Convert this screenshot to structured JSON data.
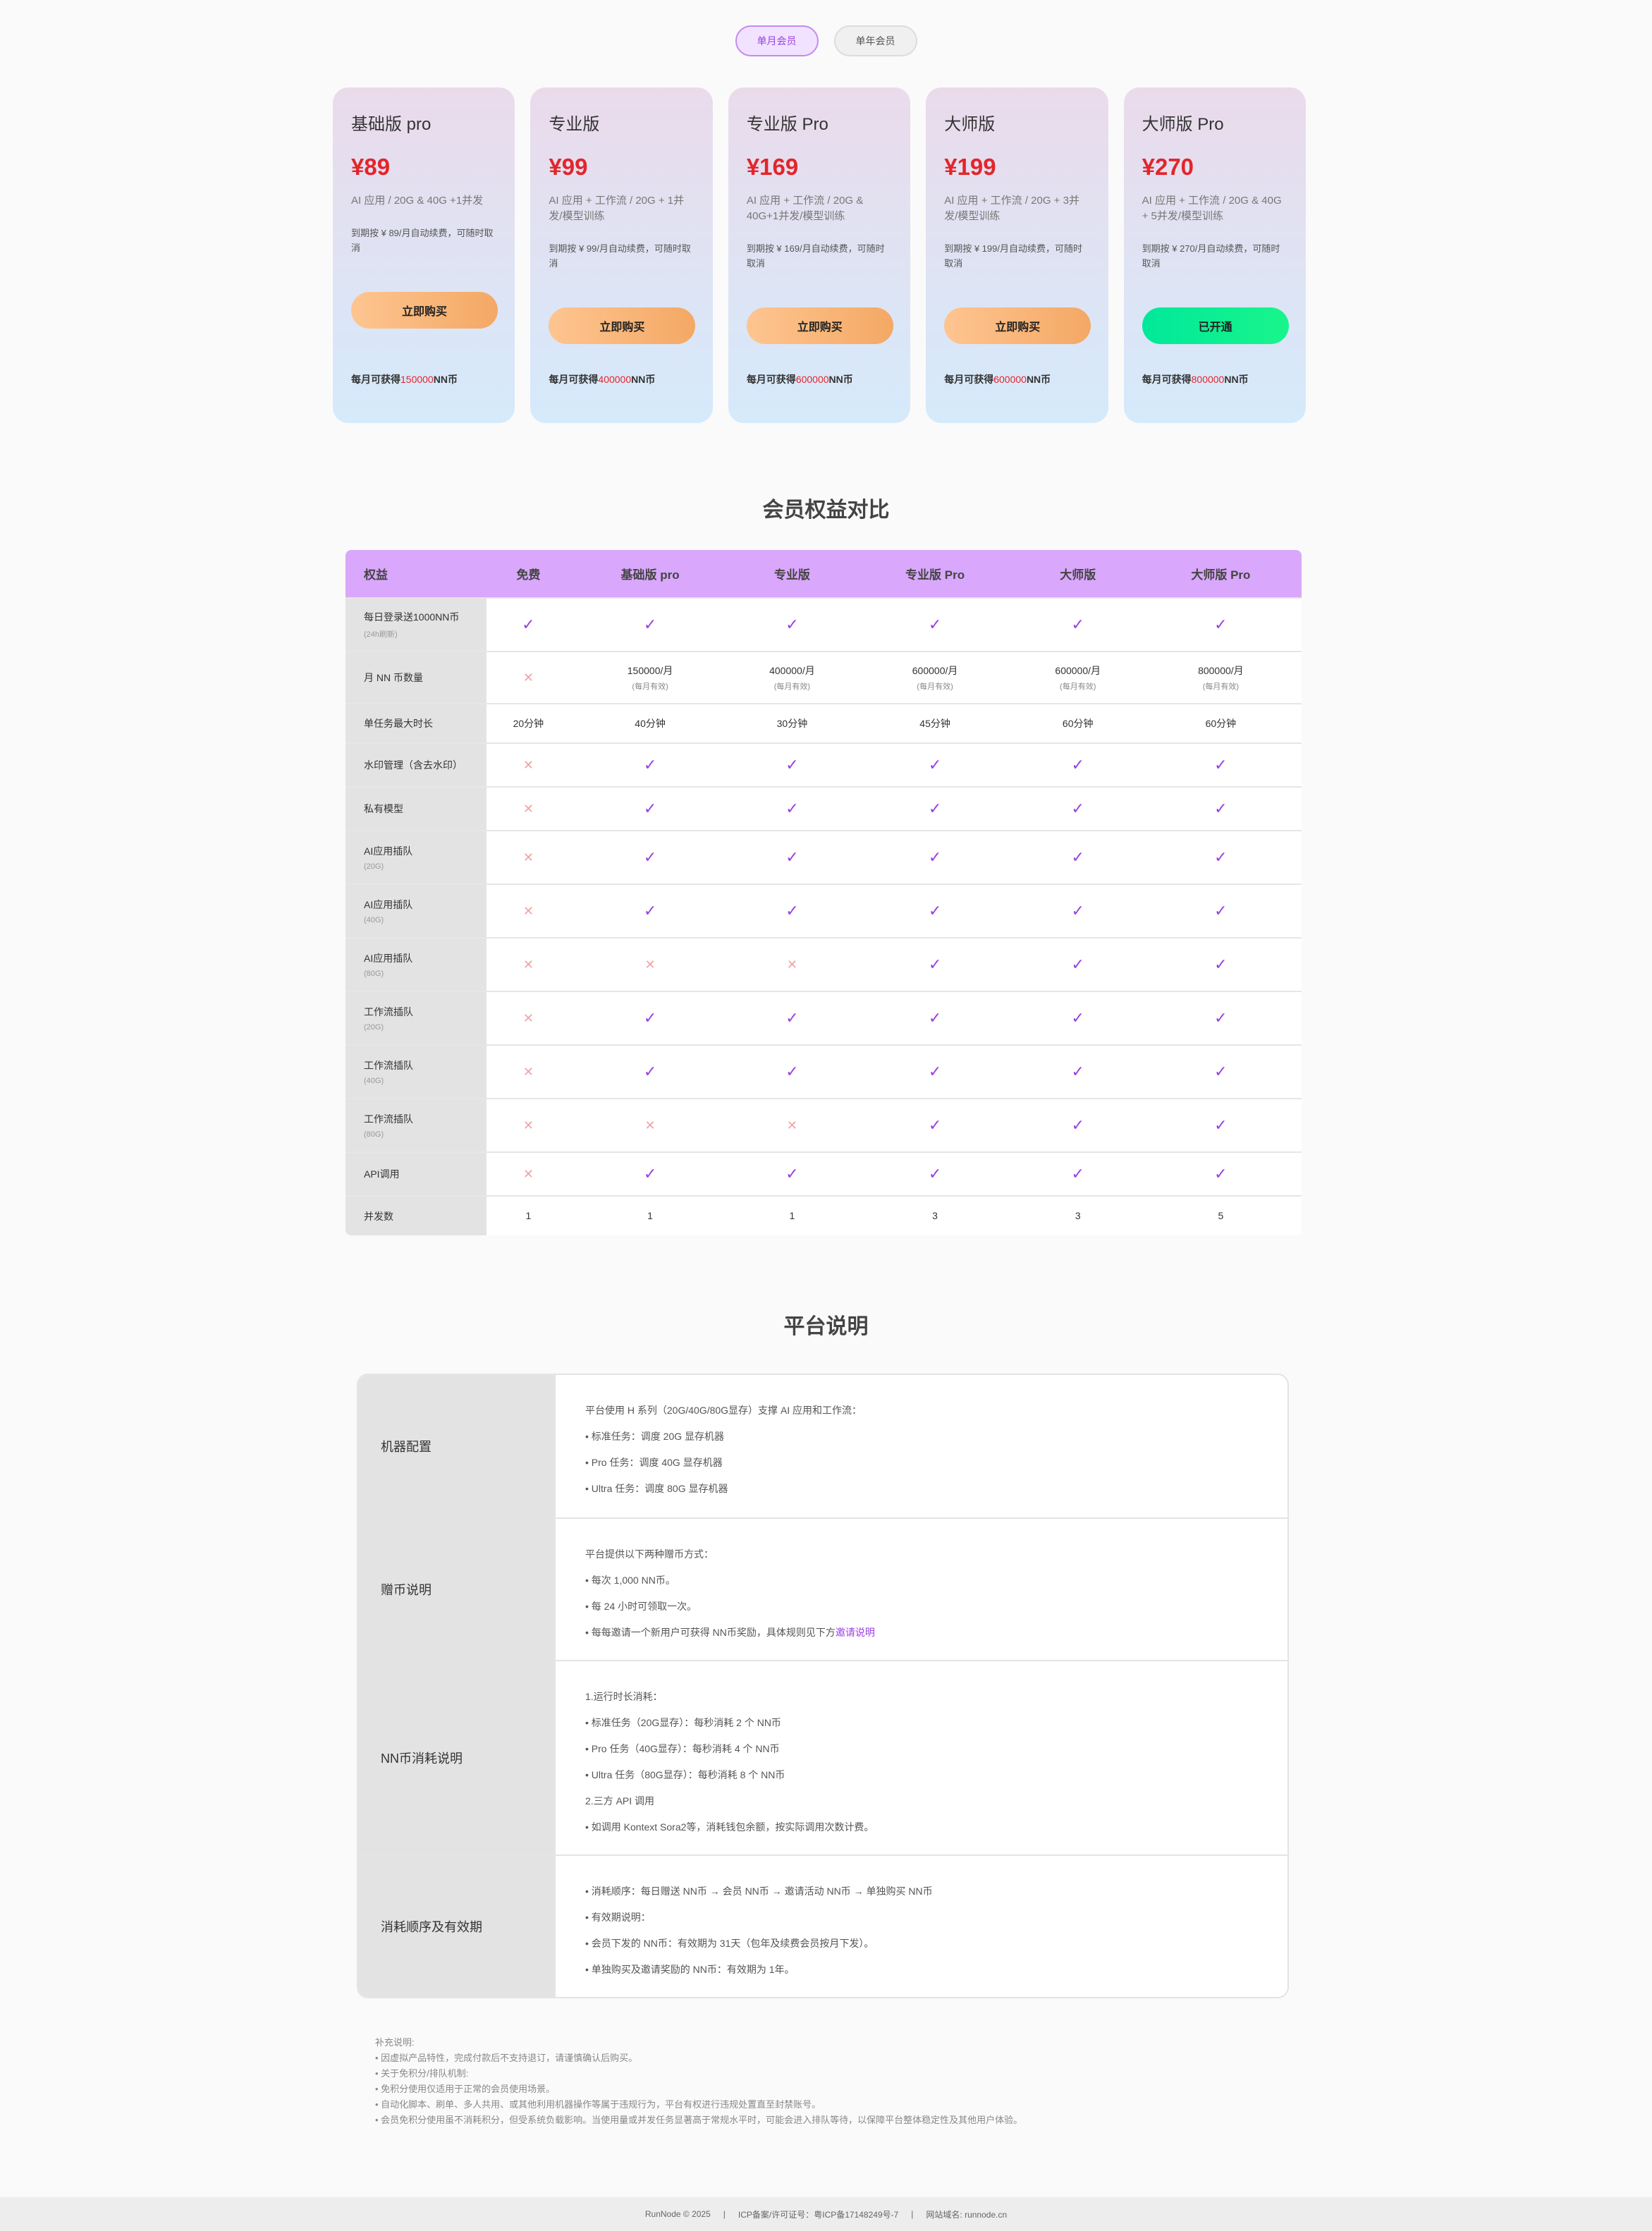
{
  "toggle": {
    "monthly": "单月会员",
    "yearly": "单年会员"
  },
  "plans": [
    {
      "name": "基础版 pro",
      "price": "¥89",
      "desc": "AI 应用 / 20G & 40G +1并发",
      "renew": "到期按 ¥ 89/月自动续费，可随时取消",
      "button": "立即购买",
      "coins_prefix": "每月可获得",
      "coins_amount": "150000",
      "coins_suffix": "NN币"
    },
    {
      "name": "专业版",
      "price": "¥99",
      "desc": "AI 应用 + 工作流 / 20G + 1并发/模型训练",
      "renew": "到期按 ¥ 99/月自动续费，可随时取消",
      "button": "立即购买",
      "coins_prefix": "每月可获得",
      "coins_amount": "400000",
      "coins_suffix": "NN币"
    },
    {
      "name": "专业版 Pro",
      "price": "¥169",
      "desc": "AI 应用 + 工作流 / 20G & 40G+1并发/模型训练",
      "renew": "到期按 ¥ 169/月自动续费，可随时取消",
      "button": "立即购买",
      "coins_prefix": "每月可获得",
      "coins_amount": "600000",
      "coins_suffix": "NN币"
    },
    {
      "name": "大师版",
      "price": "¥199",
      "desc": "AI 应用 + 工作流 / 20G + 3并发/模型训练",
      "renew": "到期按 ¥ 199/月自动续费，可随时取消",
      "button": "立即购买",
      "coins_prefix": "每月可获得",
      "coins_amount": "600000",
      "coins_suffix": "NN币"
    },
    {
      "name": "大师版 Pro",
      "price": "¥270",
      "desc": "AI 应用 + 工作流 / 20G & 40G + 5并发/模型训练",
      "renew": "到期按 ¥ 270/月自动续费，可随时取消",
      "button": "已开通",
      "coins_prefix": "每月可获得",
      "coins_amount": "800000",
      "coins_suffix": "NN币"
    }
  ],
  "compare": {
    "title": "会员权益对比",
    "headers": [
      "权益",
      "免费",
      "基础版 pro",
      "专业版",
      "专业版 Pro",
      "大师版",
      "大师版 Pro"
    ],
    "rows": [
      {
        "label": "每日登录送1000NN币",
        "sub": "(24h刷新)",
        "cells": [
          "✓",
          "✓",
          "✓",
          "✓",
          "✓",
          "✓"
        ]
      },
      {
        "label": "月 NN 币数量",
        "sub": "",
        "cells": [
          "✕",
          "150000/月|(每月有效)",
          "400000/月|(每月有效)",
          "600000/月|(每月有效)",
          "600000/月|(每月有效)",
          "800000/月|(每月有效)"
        ]
      },
      {
        "label": "单任务最大时长",
        "sub": "",
        "cells": [
          "20分钟",
          "40分钟",
          "30分钟",
          "45分钟",
          "60分钟",
          "60分钟"
        ]
      },
      {
        "label": "水印管理（含去水印）",
        "sub": "",
        "cells": [
          "✕",
          "✓",
          "✓",
          "✓",
          "✓",
          "✓"
        ]
      },
      {
        "label": "私有模型",
        "sub": "",
        "cells": [
          "✕",
          "✓",
          "✓",
          "✓",
          "✓",
          "✓"
        ]
      },
      {
        "label": "AI应用插队",
        "sub": "(20G)",
        "cells": [
          "✕",
          "✓",
          "✓",
          "✓",
          "✓",
          "✓"
        ]
      },
      {
        "label": "AI应用插队",
        "sub": "(40G)",
        "cells": [
          "✕",
          "✓",
          "✓",
          "✓",
          "✓",
          "✓"
        ]
      },
      {
        "label": "AI应用插队",
        "sub": "(80G)",
        "cells": [
          "✕",
          "✕",
          "✕",
          "✓",
          "✓",
          "✓"
        ]
      },
      {
        "label": "工作流插队",
        "sub": "(20G)",
        "cells": [
          "✕",
          "✓",
          "✓",
          "✓",
          "✓",
          "✓"
        ]
      },
      {
        "label": "工作流插队",
        "sub": "(40G)",
        "cells": [
          "✕",
          "✓",
          "✓",
          "✓",
          "✓",
          "✓"
        ]
      },
      {
        "label": "工作流插队",
        "sub": "(80G)",
        "cells": [
          "✕",
          "✕",
          "✕",
          "✓",
          "✓",
          "✓"
        ]
      },
      {
        "label": "API调用",
        "sub": "",
        "cells": [
          "✕",
          "✓",
          "✓",
          "✓",
          "✓",
          "✓"
        ]
      },
      {
        "label": "并发数",
        "sub": "",
        "cells": [
          "1",
          "1",
          "1",
          "3",
          "3",
          "5"
        ]
      }
    ]
  },
  "platform": {
    "title": "平台说明",
    "sections": [
      {
        "label": "机器配置",
        "lines": [
          "平台使用 H 系列（20G/40G/80G显存）支撑 AI 应用和工作流：",
          "• 标准任务：调度 20G 显存机器",
          "• Pro 任务：调度 40G 显存机器",
          "• Ultra 任务：调度 80G 显存机器"
        ]
      },
      {
        "label": "赠币说明",
        "lines": [
          "平台提供以下两种赠币方式：",
          "• 每次 1,000 NN币。",
          "• 每 24 小时可领取一次。",
          "• 每每邀请一个新用户可获得 NN币奖励，具体规则见下方"
        ],
        "link": "邀请说明"
      },
      {
        "label": "NN币消耗说明",
        "lines": [
          "1.运行时长消耗：",
          "• 标准任务（20G显存）：每秒消耗 2 个 NN币",
          "• Pro 任务（40G显存）：每秒消耗 4 个 NN币",
          "• Ultra 任务（80G显存）：每秒消耗 8 个 NN币",
          "2.三方 API 调用",
          "• 如调用 Kontext Sora2等，消耗钱包余额，按实际调用次数计费。"
        ]
      },
      {
        "label": "消耗顺序及有效期",
        "lines": [
          "• 消耗顺序：每日赠送 NN币 → 会员 NN币 → 邀请活动 NN币 → 单独购买 NN币",
          "• 有效期说明：",
          "• 会员下发的 NN币：有效期为 31天（包年及续费会员按月下发）。",
          "• 单独购买及邀请奖励的 NN币：有效期为 1年。"
        ]
      }
    ]
  },
  "notes": [
    "补充说明:",
    "• 因虚拟产品特性，完成付款后不支持退订，请谨慎确认后购买。",
    "• 关于免积分/排队机制:",
    "• 免积分使用仅适用于正常的会员使用场景。",
    "• 自动化脚本、刷单、多人共用、或其他利用机器操作等属于违规行为，平台有权进行违规处置直至封禁账号。",
    "• 会员免积分使用虽不消耗积分，但受系统负载影响。当使用量或并发任务显著高于常规水平时，可能会进入排队等待，以保障平台整体稳定性及其他用户体验。"
  ],
  "footer": {
    "copyright": "RunNode © 2025",
    "sep1": "|",
    "icp": "ICP备案/许可证号：粤ICP备17148249号-7",
    "sep2": "|",
    "domain": "网站域名: runnode.cn"
  }
}
